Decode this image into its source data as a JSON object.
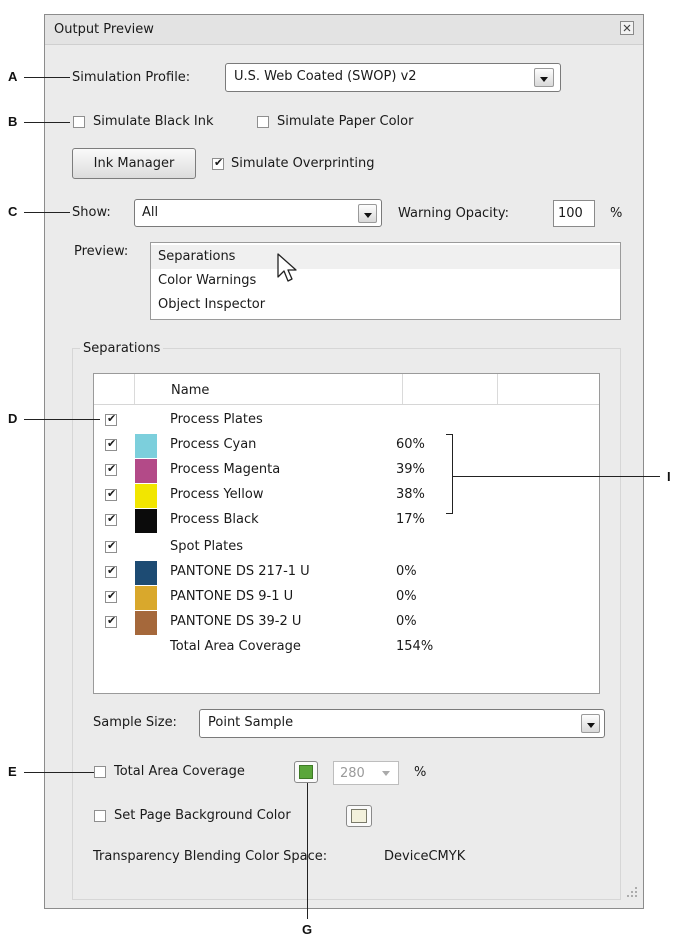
{
  "window": {
    "title": "Output Preview",
    "close_glyph": "⊠"
  },
  "callouts": {
    "a": "A",
    "b": "B",
    "c": "C",
    "d": "D",
    "e": "E",
    "g": "G",
    "i": "I"
  },
  "simulation": {
    "profile_label": "Simulation Profile:",
    "profile_value": "U.S. Web Coated (SWOP) v2",
    "black_ink_label": "Simulate Black Ink",
    "black_ink_checked": false,
    "paper_color_label": "Simulate Paper Color",
    "paper_color_checked": false,
    "ink_manager_label": "Ink Manager",
    "overprinting_label": "Simulate Overprinting",
    "overprinting_checked": true
  },
  "show": {
    "label": "Show:",
    "value": "All",
    "warning_opacity_label": "Warning Opacity:",
    "warning_opacity_value": "100",
    "percent": "%"
  },
  "preview": {
    "label": "Preview:",
    "items": [
      "Separations",
      "Color Warnings",
      "Object Inspector"
    ],
    "selected": "Separations"
  },
  "separations": {
    "group_label": "Separations",
    "header": "Name",
    "rows": [
      {
        "checked": true,
        "swatch": "",
        "name": "Process Plates",
        "value": ""
      },
      {
        "checked": true,
        "swatch": "#7ccfdc",
        "name": "Process Cyan",
        "value": "60%"
      },
      {
        "checked": true,
        "swatch": "#b34a88",
        "name": "Process Magenta",
        "value": "39%"
      },
      {
        "checked": true,
        "swatch": "#f2e600",
        "name": "Process Yellow",
        "value": "38%"
      },
      {
        "checked": true,
        "swatch": "#0b0b0b",
        "name": "Process Black",
        "value": "17%"
      },
      {
        "checked": true,
        "swatch": "",
        "name": "Spot Plates",
        "value": ""
      },
      {
        "checked": true,
        "swatch": "#1d4b73",
        "name": "PANTONE DS 217-1 U",
        "value": "0%"
      },
      {
        "checked": true,
        "swatch": "#d9a82c",
        "name": "PANTONE DS 9-1 U",
        "value": "0%"
      },
      {
        "checked": true,
        "swatch": "#a5683b",
        "name": "PANTONE DS 39-2 U",
        "value": "0%"
      },
      {
        "checked": false,
        "swatch": "",
        "name": "Total Area Coverage",
        "value": "154%"
      }
    ],
    "sample_size_label": "Sample Size:",
    "sample_size_value": "Point Sample",
    "tac_label": "Total Area Coverage",
    "tac_checked": false,
    "tac_color": "#5aa63a",
    "tac_value": "280",
    "tac_percent": "%",
    "page_bg_label": "Set Page Background Color",
    "page_bg_checked": false,
    "page_bg_color": "#f3f1dc",
    "blend_label": "Transparency Blending Color Space:",
    "blend_value": "DeviceCMYK"
  }
}
